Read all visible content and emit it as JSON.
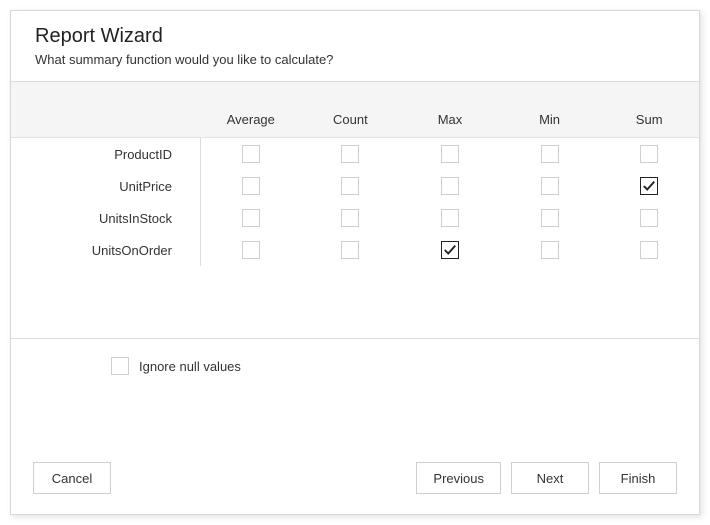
{
  "header": {
    "title": "Report Wizard",
    "subtitle": "What summary function would you like to calculate?"
  },
  "columns": [
    "Average",
    "Count",
    "Max",
    "Min",
    "Sum"
  ],
  "rows": [
    {
      "label": "ProductID",
      "checks": [
        false,
        false,
        false,
        false,
        false
      ]
    },
    {
      "label": "UnitPrice",
      "checks": [
        false,
        false,
        false,
        false,
        true
      ]
    },
    {
      "label": "UnitsInStock",
      "checks": [
        false,
        false,
        false,
        false,
        false
      ]
    },
    {
      "label": "UnitsOnOrder",
      "checks": [
        false,
        false,
        true,
        false,
        false
      ]
    }
  ],
  "options": {
    "ignore_null_label": "Ignore null values",
    "ignore_null_checked": false
  },
  "footer": {
    "cancel": "Cancel",
    "previous": "Previous",
    "next": "Next",
    "finish": "Finish"
  }
}
